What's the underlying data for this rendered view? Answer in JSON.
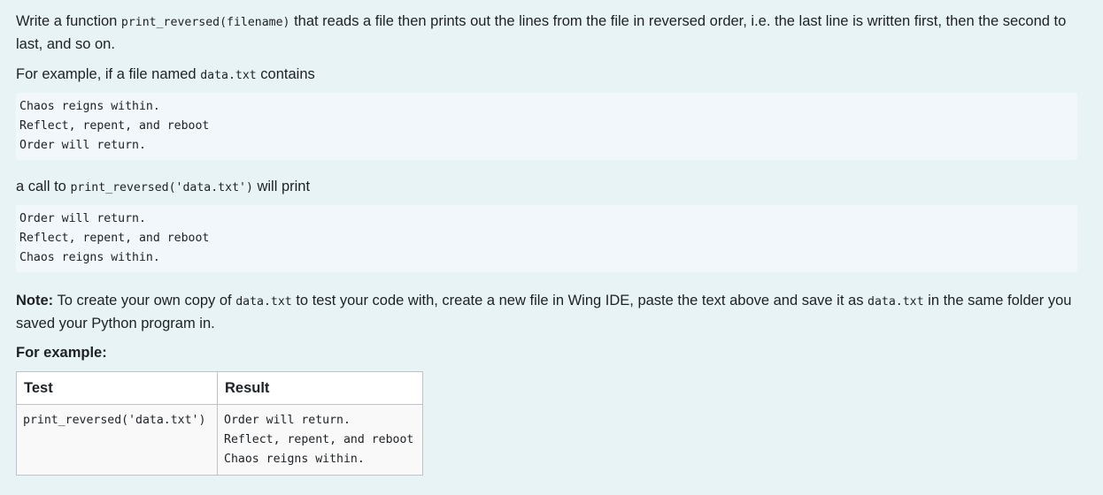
{
  "question": {
    "intro_text_1": "Write a function ",
    "intro_code": "print_reversed(filename)",
    "intro_text_2": " that reads a file then prints out the lines from the file in reversed order, i.e. the last line is written first, then the second to last, and so on.",
    "example_text_1": "For example, if a file named ",
    "example_code": "data.txt",
    "example_text_2": " contains",
    "file_lines": [
      "Chaos reigns within.",
      "Reflect, repent, and reboot",
      "Order will return."
    ],
    "call_text_1": "a call to ",
    "call_code": "print_reversed('data.txt')",
    "call_text_2": " will print",
    "output_lines": [
      "Order will return.",
      "Reflect, repent, and reboot",
      "Chaos reigns within."
    ],
    "note_label": "Note:",
    "note_text_1": " To create your own copy of ",
    "note_code_1": "data.txt",
    "note_text_2": " to test your code with, create a new file in Wing IDE, paste the text above and save it as ",
    "note_code_2": "data.txt",
    "note_text_3": " in the same folder you saved your Python program in.",
    "for_example_heading": "For example:"
  },
  "examples_table": {
    "headers": [
      "Test",
      "Result"
    ],
    "rows": [
      {
        "test": "print_reversed('data.txt')",
        "result": "Order will return.\nReflect, repent, and reboot\nChaos reigns within."
      }
    ]
  }
}
